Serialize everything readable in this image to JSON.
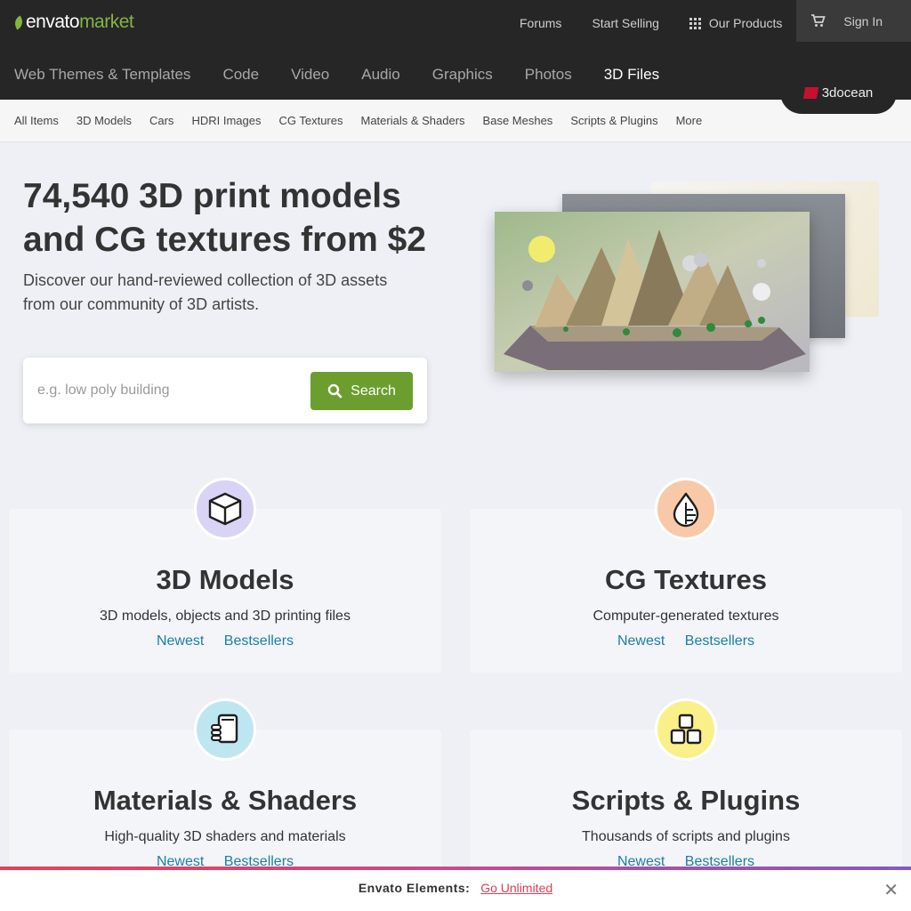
{
  "logo": {
    "part1": "envato",
    "part2": "market"
  },
  "top_nav": {
    "forums": "Forums",
    "start_selling": "Start Selling",
    "our_products": "Our Products",
    "sign_in": "Sign In"
  },
  "categories": [
    {
      "label": "Web Themes & Templates",
      "active": false
    },
    {
      "label": "Code",
      "active": false
    },
    {
      "label": "Video",
      "active": false
    },
    {
      "label": "Audio",
      "active": false
    },
    {
      "label": "Graphics",
      "active": false
    },
    {
      "label": "Photos",
      "active": false
    },
    {
      "label": "3D Files",
      "active": true
    }
  ],
  "site_badge": "3docean",
  "sub_nav": [
    "All Items",
    "3D Models",
    "Cars",
    "HDRI Images",
    "CG Textures",
    "Materials & Shaders",
    "Base Meshes",
    "Scripts & Plugins",
    "More"
  ],
  "hero": {
    "title": "74,540 3D print models and CG textures from $2",
    "subtitle": "Discover our hand-reviewed collection of 3D assets from our community of 3D artists."
  },
  "search": {
    "placeholder": "e.g. low poly building",
    "button": "Search"
  },
  "cards": [
    {
      "title": "3D Models",
      "desc": "3D models, objects and 3D printing files",
      "newest": "Newest",
      "bestsellers": "Bestsellers",
      "icon": "cube-icon",
      "icon_bg": "#d9d3f5"
    },
    {
      "title": "CG Textures",
      "desc": "Computer-generated textures",
      "newest": "Newest",
      "bestsellers": "Bestsellers",
      "icon": "drop-icon",
      "icon_bg": "#f8c9a8"
    },
    {
      "title": "Materials & Shaders",
      "desc": "High-quality 3D shaders and materials",
      "newest": "Newest",
      "bestsellers": "Bestsellers",
      "icon": "materials-icon",
      "icon_bg": "#bde6f1"
    },
    {
      "title": "Scripts & Plugins",
      "desc": "Thousands of scripts and plugins",
      "newest": "Newest",
      "bestsellers": "Bestsellers",
      "icon": "blocks-icon",
      "icon_bg": "#faf08a"
    }
  ],
  "banner": {
    "label": "Envato Elements:",
    "link": "Go Unlimited",
    "close": "✕"
  },
  "colors": {
    "accent_green": "#82b541",
    "button_green": "#6b9e2e",
    "link_blue": "#1a7fa3",
    "dark_bg": "#262626"
  }
}
